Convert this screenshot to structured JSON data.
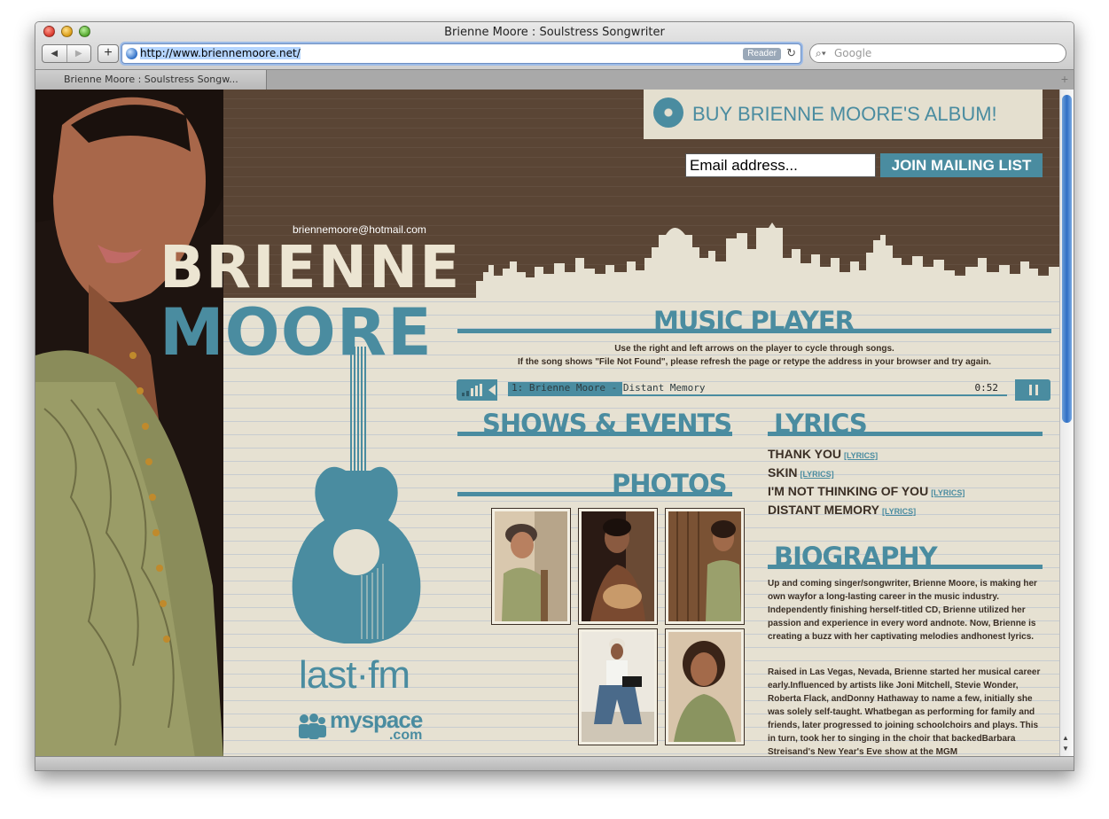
{
  "browser": {
    "window_title": "Brienne Moore : Soulstress Songwriter",
    "url": "http://www.briennemoore.net/",
    "reader_label": "Reader",
    "search_placeholder": "Google",
    "tab_label": "Brienne Moore : Soulstress Songw...",
    "add_label": "+",
    "newtab_label": "+"
  },
  "site": {
    "brand_first": "BRIENNE",
    "brand_last": "MOORE",
    "contact_email": "briennemoore@hotmail.com",
    "buy_album_label": "BUY BRIENNE MOORE'S ALBUM!",
    "email_placeholder": "Email address...",
    "join_label": "JOIN MAILING LIST",
    "lastfm_label": "last·fm",
    "myspace_label": "myspace",
    "myspace_suffix": ".com"
  },
  "music_player": {
    "title": "MUSIC PLAYER",
    "note_1": "Use the right and left arrows on the player to cycle through songs.",
    "note_2": "If the song shows \"File Not Found\", please refresh the page or retype the address in your browser and try again.",
    "current_song": "1: Brienne Moore - Distant Memory",
    "time": "0:52",
    "progress": 0.23
  },
  "shows": {
    "title": "SHOWS & EVENTS"
  },
  "photos": {
    "title": "PHOTOS"
  },
  "lyrics": {
    "title": "LYRICS",
    "link_label": "[LYRICS]",
    "items": [
      "THANK YOU",
      "SKIN",
      "I'M NOT THINKING OF YOU",
      "DISTANT MEMORY"
    ]
  },
  "biography": {
    "title": "BIOGRAPHY",
    "p1": "Up and coming singer/songwriter, Brienne Moore, is making her own wayfor a long-lasting career in the music industry. Independently finishing herself-titled CD, Brienne utilized her passion and experience in every word andnote. Now, Brienne is creating a buzz with her captivating melodies andhonest lyrics.",
    "p2": "Raised in Las Vegas, Nevada, Brienne started her musical career early.Influenced by artists like Joni Mitchell, Stevie Wonder, Roberta Flack, andDonny Hathaway to name a few, initially she was solely self-taught. Whatbegan as performing for family and friends, later progressed to joining schoolchoirs and plays. This in turn, took her to singing in the choir that backedBarbara Streisand's New Year's Eve show at the MGM"
  },
  "colors": {
    "accent": "#4a8ca0",
    "brown": "#5a4535",
    "cream": "#e6e1d2"
  }
}
